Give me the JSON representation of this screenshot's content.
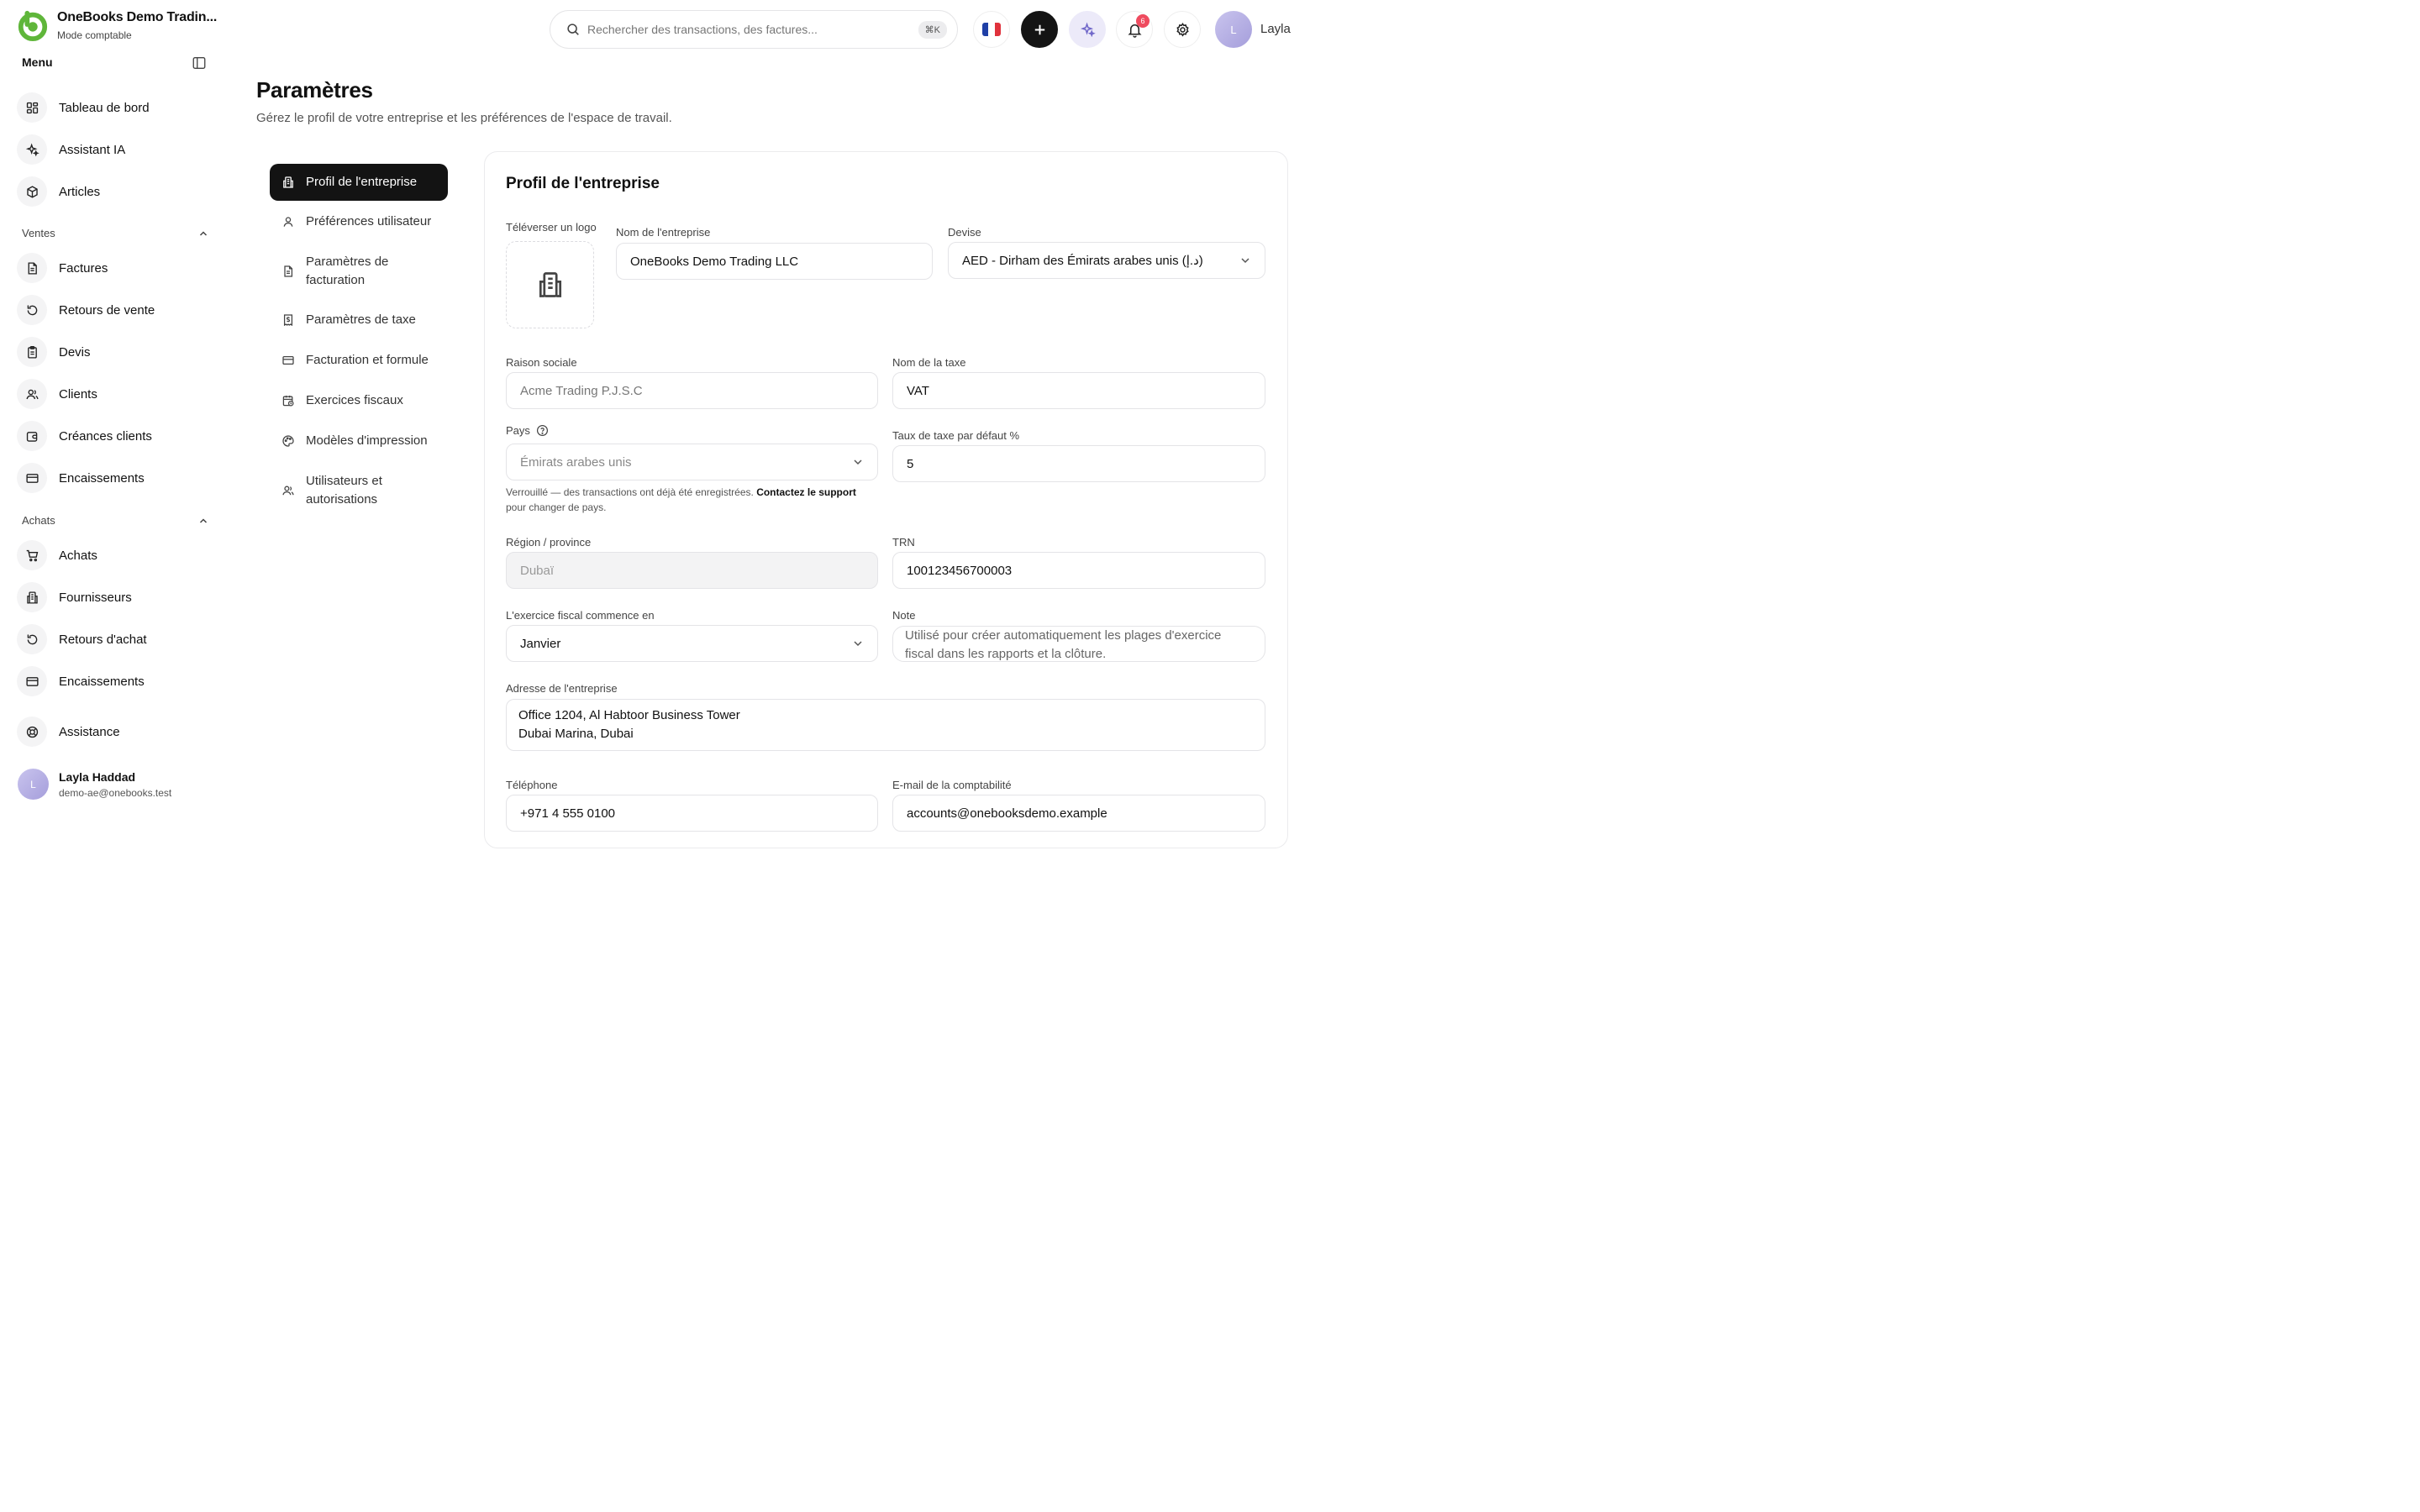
{
  "brand": {
    "name": "OneBooks Demo Tradin...",
    "mode": "Mode comptable"
  },
  "sidebar": {
    "menu_title": "Menu",
    "top_items": [
      {
        "label": "Tableau de bord",
        "icon": "dashboard-icon"
      },
      {
        "label": "Assistant IA",
        "icon": "sparkle-icon"
      },
      {
        "label": "Articles",
        "icon": "box-icon"
      }
    ],
    "sales": {
      "title": "Ventes",
      "items": [
        {
          "label": "Factures",
          "icon": "document-icon"
        },
        {
          "label": "Retours de vente",
          "icon": "return-icon"
        },
        {
          "label": "Devis",
          "icon": "clipboard-icon"
        },
        {
          "label": "Clients",
          "icon": "users-icon"
        },
        {
          "label": "Créances clients",
          "icon": "wallet-icon"
        },
        {
          "label": "Encaissements",
          "icon": "card-icon"
        }
      ]
    },
    "purchases": {
      "title": "Achats",
      "items": [
        {
          "label": "Achats",
          "icon": "cart-icon"
        },
        {
          "label": "Fournisseurs",
          "icon": "building-icon"
        },
        {
          "label": "Retours d'achat",
          "icon": "return-icon"
        },
        {
          "label": "Encaissements",
          "icon": "card-icon"
        }
      ]
    },
    "support": {
      "label": "Assistance",
      "icon": "lifebuoy-icon"
    },
    "user": {
      "initial": "L",
      "name": "Layla Haddad",
      "email": "demo-ae@onebooks.test"
    }
  },
  "topbar": {
    "search_placeholder": "Rechercher des transactions, des factures...",
    "shortcut": "⌘K",
    "notifications_count": "6",
    "user_initial": "L",
    "user_name": "Layla",
    "colors": {
      "flag_blue": "#1f3fa6",
      "flag_white": "#ffffff",
      "flag_red": "#e0323c",
      "badge": "#ef4b5f"
    }
  },
  "page": {
    "title": "Paramètres",
    "subtitle": "Gérez le profil de votre entreprise et les préférences de l'espace de travail."
  },
  "settings_nav": [
    {
      "label": "Profil de l'entreprise",
      "icon": "building-icon",
      "active": true
    },
    {
      "label": "Préférences utilisateur",
      "icon": "user-icon"
    },
    {
      "label": "Paramètres de facturation",
      "icon": "document-icon"
    },
    {
      "label": "Paramètres de taxe",
      "icon": "receipt-icon"
    },
    {
      "label": "Facturation et formule",
      "icon": "card-icon"
    },
    {
      "label": "Exercices fiscaux",
      "icon": "calendar-icon"
    },
    {
      "label": "Modèles d'impression",
      "icon": "palette-icon"
    },
    {
      "label": "Utilisateurs et autorisations",
      "icon": "users-icon"
    }
  ],
  "profile": {
    "title": "Profil de l'entreprise",
    "logo_label": "Téléverser un logo",
    "company_name": {
      "label": "Nom de l'entreprise",
      "value": "OneBooks Demo Trading LLC"
    },
    "currency": {
      "label": "Devise",
      "value": "AED - Dirham des Émirats arabes unis (د.إ)"
    },
    "legal_name": {
      "label": "Raison sociale",
      "value": "Acme Trading P.J.S.C"
    },
    "tax_name": {
      "label": "Nom de la taxe",
      "value": "VAT"
    },
    "country": {
      "label": "Pays",
      "value": "Émirats arabes unis"
    },
    "country_help": {
      "text": "Verrouillé — des transactions ont déjà été enregistrées.",
      "link": "Contactez le support",
      "suffix": "pour changer de pays."
    },
    "default_tax": {
      "label": "Taux de taxe par défaut %",
      "value": "5"
    },
    "region": {
      "label": "Région / province",
      "value": "Dubaï"
    },
    "trn": {
      "label": "TRN",
      "value": "100123456700003"
    },
    "fiscal_start": {
      "label": "L'exercice fiscal commence en",
      "value": "Janvier"
    },
    "note": {
      "label": "Note",
      "value": "Utilisé pour créer automatiquement les plages d'exercice fiscal dans les rapports et la clôture."
    },
    "address": {
      "label": "Adresse de l'entreprise",
      "line1": "Office 1204, Al Habtoor Business Tower",
      "line2": "Dubai Marina, Dubai"
    },
    "phone": {
      "label": "Téléphone",
      "value": "+971 4 555 0100"
    },
    "accounting_email": {
      "label": "E-mail de la comptabilité",
      "value": "accounts@onebooksdemo.example"
    }
  }
}
